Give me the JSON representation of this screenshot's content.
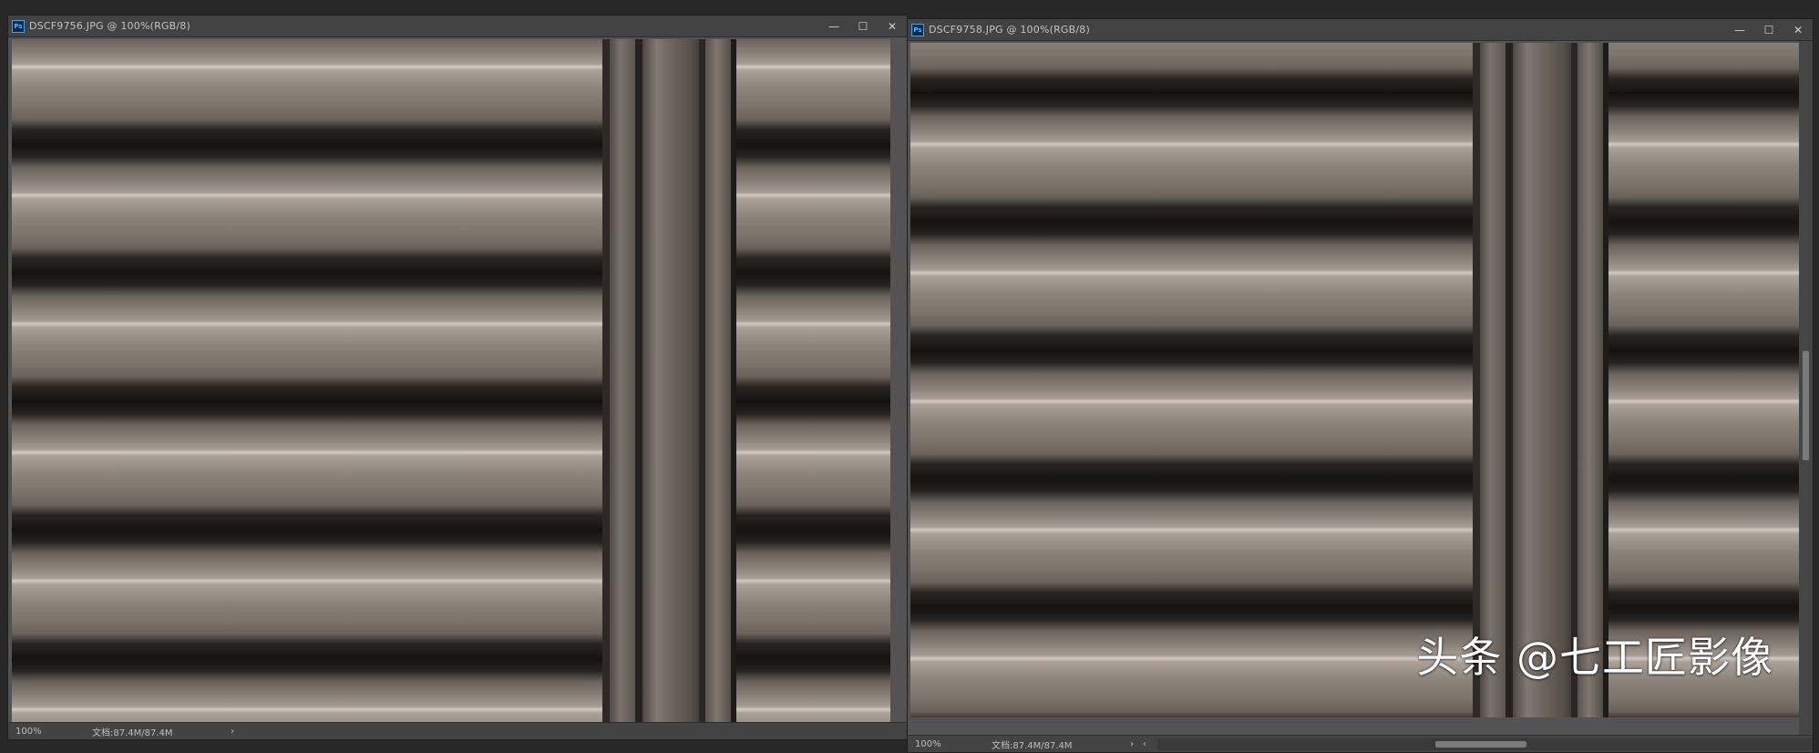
{
  "windows": [
    {
      "title": "DSCF9756.JPG @ 100%(RGB/8)",
      "zoom": "100%",
      "doc_size": "文档:87.4M/87.4M"
    },
    {
      "title": "DSCF9758.JPG @ 100%(RGB/8)",
      "zoom": "100%",
      "doc_size": "文档:87.4M/87.4M"
    }
  ],
  "controls": {
    "minimize": "—",
    "maximize": "☐",
    "close": "✕"
  },
  "app_icon": "Ps",
  "status_arrow": "›",
  "scroll_arrow_left": "‹",
  "watermark": "头条 @七工匠影像",
  "colors": {
    "app_bg": "#282828",
    "panel": "#535353",
    "titlebar": "#424242",
    "metal_light": "#d1cac3",
    "metal_dark": "#141210"
  }
}
